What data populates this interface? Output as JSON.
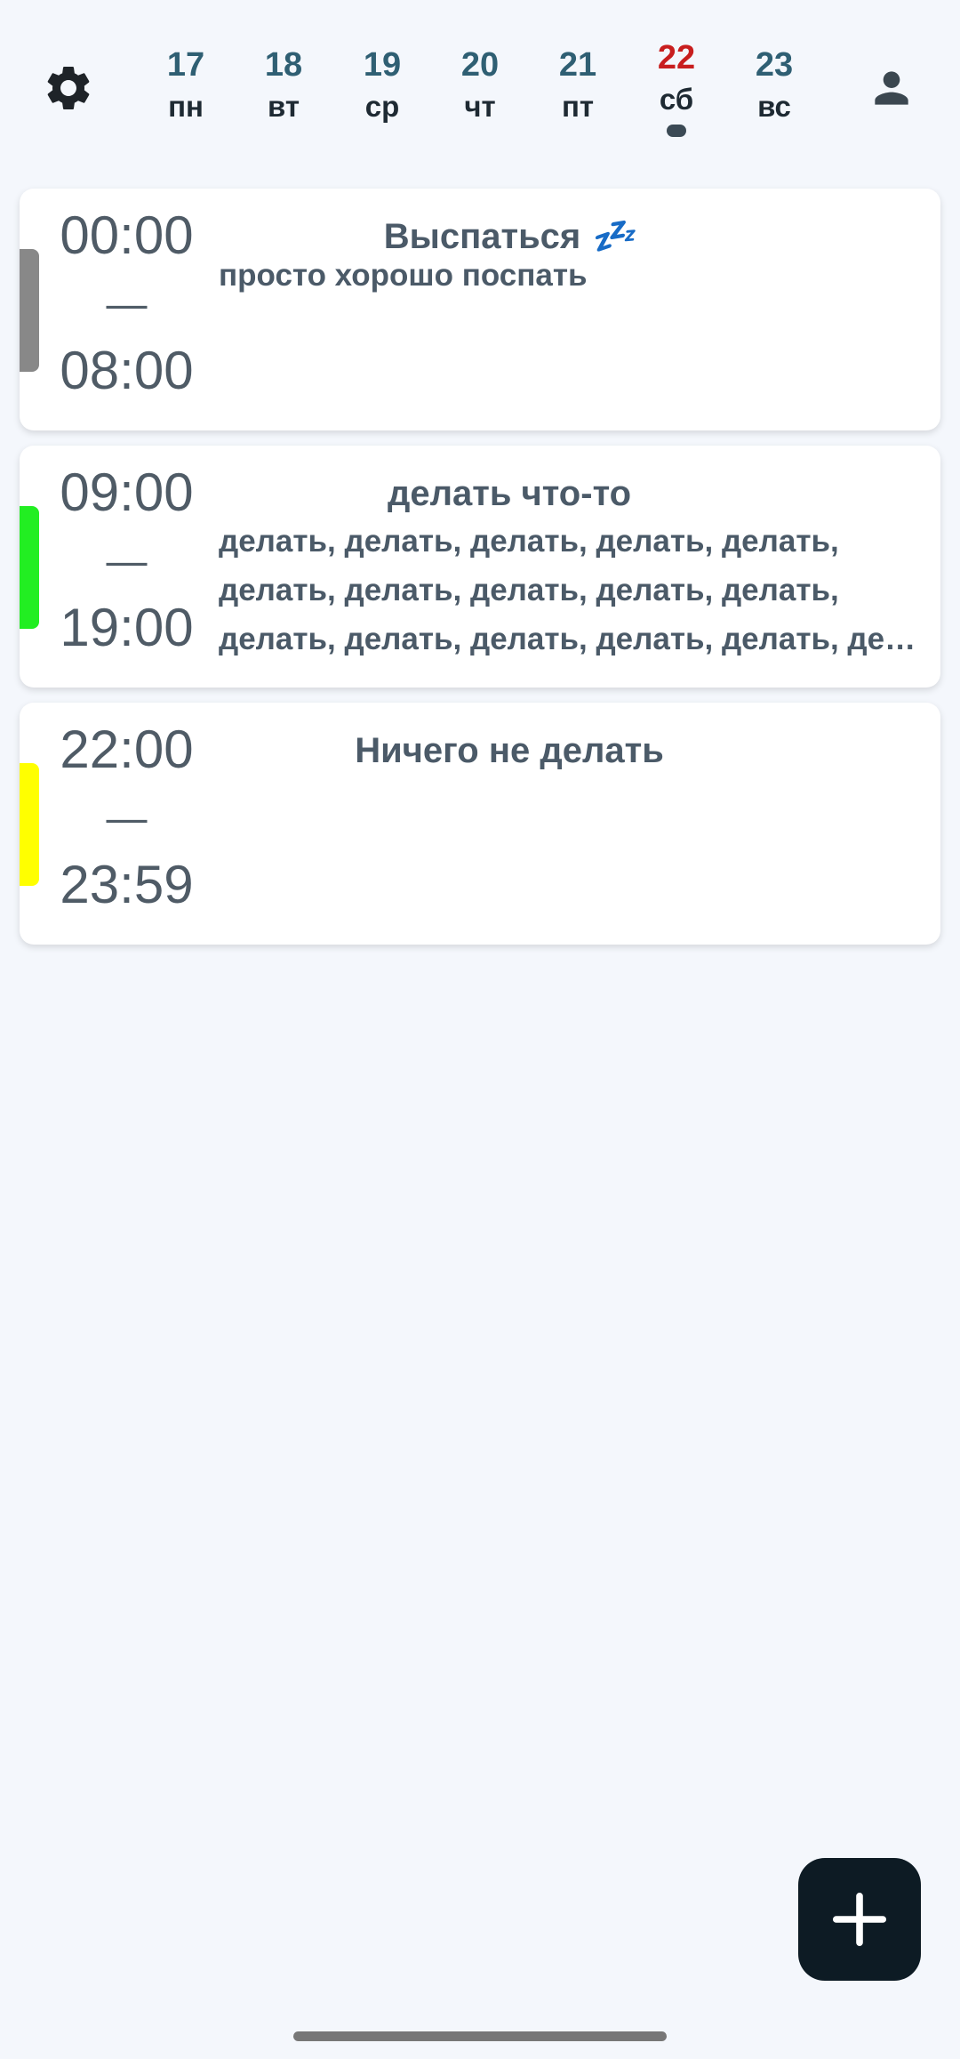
{
  "header": {
    "settings_icon": "gear-icon",
    "profile_icon": "person-icon",
    "days": [
      {
        "num": "17",
        "name": "пн"
      },
      {
        "num": "18",
        "name": "вт"
      },
      {
        "num": "19",
        "name": "ср"
      },
      {
        "num": "20",
        "name": "чт"
      },
      {
        "num": "21",
        "name": "пт"
      },
      {
        "num": "22",
        "name": "сб",
        "selected": true
      },
      {
        "num": "23",
        "name": "вс"
      }
    ],
    "selected_color": "#c81e1e",
    "day_color": "#2f5f73"
  },
  "events": [
    {
      "start": "00:00",
      "dash": "—",
      "end": "08:00",
      "title": "Выспаться",
      "emoji": "💤",
      "description": "просто хорошо поспать",
      "color": "#888888"
    },
    {
      "start": "09:00",
      "dash": "—",
      "end": "19:00",
      "title": "делать что-то",
      "description_lines": [
        "делать, делать, делать, делать, делать,",
        "делать, делать, делать, делать, делать,",
        "делать, делать, делать, делать, делать, делать"
      ],
      "color": "#22ee22"
    },
    {
      "start": "22:00",
      "dash": "—",
      "end": "23:59",
      "title": "Ничего не делать",
      "color": "#ffff00"
    }
  ],
  "fab": {
    "icon": "plus-icon",
    "color": "#0d1b24"
  }
}
